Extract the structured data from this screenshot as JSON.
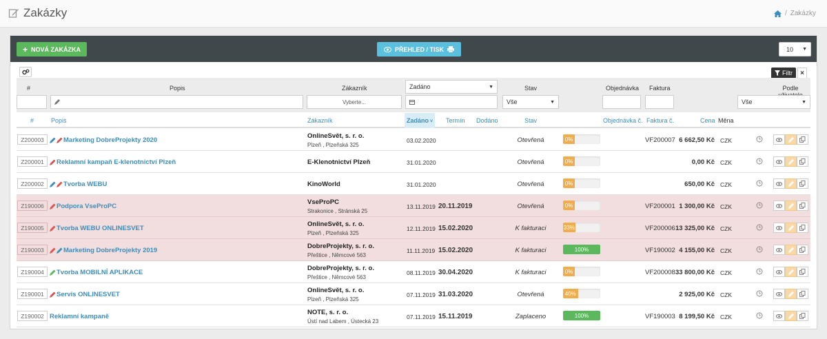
{
  "header": {
    "title": "Zakázky",
    "breadcrumb": {
      "current": "Zakázky",
      "separator": "/"
    }
  },
  "toolbar": {
    "new_label": "NOVÁ ZAKÁZKA",
    "overview_label": "PŘEHLED / TISK",
    "page_size": "10"
  },
  "filters": {
    "filter_button": "Filtr",
    "labels": {
      "num": "#",
      "popis": "Popis",
      "zakaznik": "Zákazník",
      "stav": "Stav",
      "objednavka": "Objednávka",
      "faktura": "Faktura",
      "podle": "Podle uživatele"
    },
    "zadano_select": "Zadáno",
    "zakaznik_placeholder": "Vyberte...",
    "stav_select": "Vše",
    "podle_select": "Vše"
  },
  "columns": {
    "num": "#",
    "popis": "Popis",
    "zakaznik": "Zákazník",
    "zadano": "Zadáno",
    "termin": "Termín",
    "dodano": "Dodáno",
    "stav": "Stav",
    "objednavka": "Objednávka č.",
    "faktura": "Faktura č.",
    "cena": "Cena",
    "mena": "Měna"
  },
  "rows": [
    {
      "code": "Z200003",
      "pens": [
        "blue",
        "red"
      ],
      "popis": "Marketing DobreProjekty 2020",
      "customer": "OnlineSvět, s. r. o.",
      "address": "Plzeň , Plzeňská 325",
      "zadano": "03.02.2020",
      "termin": "",
      "stav": "Otevřená",
      "progress": 0,
      "progress_label": "0%",
      "progress_color": "#f0ad4e",
      "faktura": "VF200007",
      "cena": "6 662,50 Kč",
      "mena": "CZK",
      "highlight": false
    },
    {
      "code": "Z200001",
      "pens": [
        "red"
      ],
      "popis": "Reklamní kampaň E-klenotnictví Plzeň",
      "customer": "E-Klenotnictví Plzeň",
      "address": "",
      "zadano": "31.01.2020",
      "termin": "",
      "stav": "Otevřená",
      "progress": 0,
      "progress_label": "0%",
      "progress_color": "#f0ad4e",
      "faktura": "",
      "cena": "0,00 Kč",
      "mena": "CZK",
      "highlight": false
    },
    {
      "code": "Z200002",
      "pens": [
        "blue",
        "red"
      ],
      "popis": "Tvorba WEBU",
      "customer": "KinoWorld",
      "address": "",
      "zadano": "31.01.2020",
      "termin": "",
      "stav": "Otevřená",
      "progress": 0,
      "progress_label": "0%",
      "progress_color": "#f0ad4e",
      "faktura": "",
      "cena": "650,00 Kč",
      "mena": "CZK",
      "highlight": false
    },
    {
      "code": "Z190006",
      "pens": [
        "red"
      ],
      "popis": "Podpora VseProPC",
      "customer": "VseProPC",
      "address": "Strakonice , Stránská 25",
      "zadano": "13.11.2019",
      "termin": "20.11.2019",
      "stav": "Otevřená",
      "progress": 0,
      "progress_label": "0%",
      "progress_color": "#f0ad4e",
      "faktura": "VF200001",
      "cena": "1 300,00 Kč",
      "mena": "CZK",
      "highlight": true
    },
    {
      "code": "Z190005",
      "pens": [
        "red"
      ],
      "popis": "Tvorba WEBU ONLINESVET",
      "customer": "OnlineSvět, s. r. o.",
      "address": "Plzeň , Plzeňská 325",
      "zadano": "12.11.2019",
      "termin": "15.02.2020",
      "stav": "K fakturaci",
      "progress": 33,
      "progress_label": "33%",
      "progress_color": "#f0ad4e",
      "faktura": "VF200006",
      "cena": "13 325,00 Kč",
      "mena": "CZK",
      "highlight": true
    },
    {
      "code": "Z190003",
      "pens": [
        "red",
        "blue"
      ],
      "popis": "Marketing DobreProjekty 2019",
      "customer": "DobreProjekty, s. r. o.",
      "address": "Přeštice , Němcové 563",
      "zadano": "11.11.2019",
      "termin": "15.02.2020",
      "stav": "K fakturaci",
      "progress": 100,
      "progress_label": "100%",
      "progress_color": "#5cb85c",
      "faktura": "VF190002",
      "cena": "4 155,00 Kč",
      "mena": "CZK",
      "highlight": true
    },
    {
      "code": "Z190004",
      "pens": [
        "green"
      ],
      "popis": "Tvorba MOBILNÍ APLIKACE",
      "customer": "DobreProjekty, s. r. o.",
      "address": "Přeštice , Němcové 563",
      "zadano": "08.11.2019",
      "termin": "30.04.2020",
      "stav": "K fakturaci",
      "progress": 0,
      "progress_label": "0%",
      "progress_color": "#f0ad4e",
      "faktura": "VF200008",
      "cena": "33 800,00 Kč",
      "mena": "CZK",
      "highlight": false
    },
    {
      "code": "Z190001",
      "pens": [
        "red"
      ],
      "popis": "Servis ONLINESVET",
      "customer": "OnlineSvět, s. r. o.",
      "address": "Plzeň , Plzeňská 325",
      "zadano": "07.11.2019",
      "termin": "31.03.2020",
      "stav": "Otevřená",
      "progress": 40,
      "progress_label": "40%",
      "progress_color": "#f0ad4e",
      "faktura": "",
      "cena": "2 925,00 Kč",
      "mena": "CZK",
      "highlight": false
    },
    {
      "code": "Z190002",
      "pens": [],
      "popis": "Reklamní kampaně",
      "customer": "NOTE, s. r. o.",
      "address": "Ústí nad Labem , Ústecká 23",
      "zadano": "07.11.2019",
      "termin": "15.11.2019",
      "stav": "Zaplaceno",
      "progress": 100,
      "progress_label": "100%",
      "progress_color": "#5cb85c",
      "faktura": "VF190003",
      "cena": "8 199,50 Kč",
      "mena": "CZK",
      "highlight": false
    }
  ]
}
